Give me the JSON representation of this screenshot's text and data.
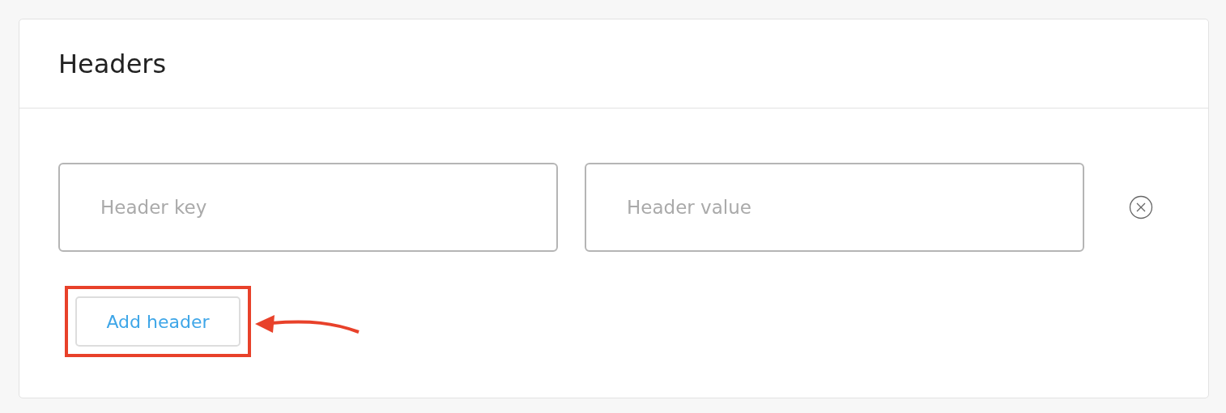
{
  "title": "Headers",
  "fields": [
    {
      "placeholder": "Header key"
    },
    {
      "placeholder": "Header value"
    }
  ],
  "add_button": {
    "label": "Add header",
    "highlighted": true
  }
}
